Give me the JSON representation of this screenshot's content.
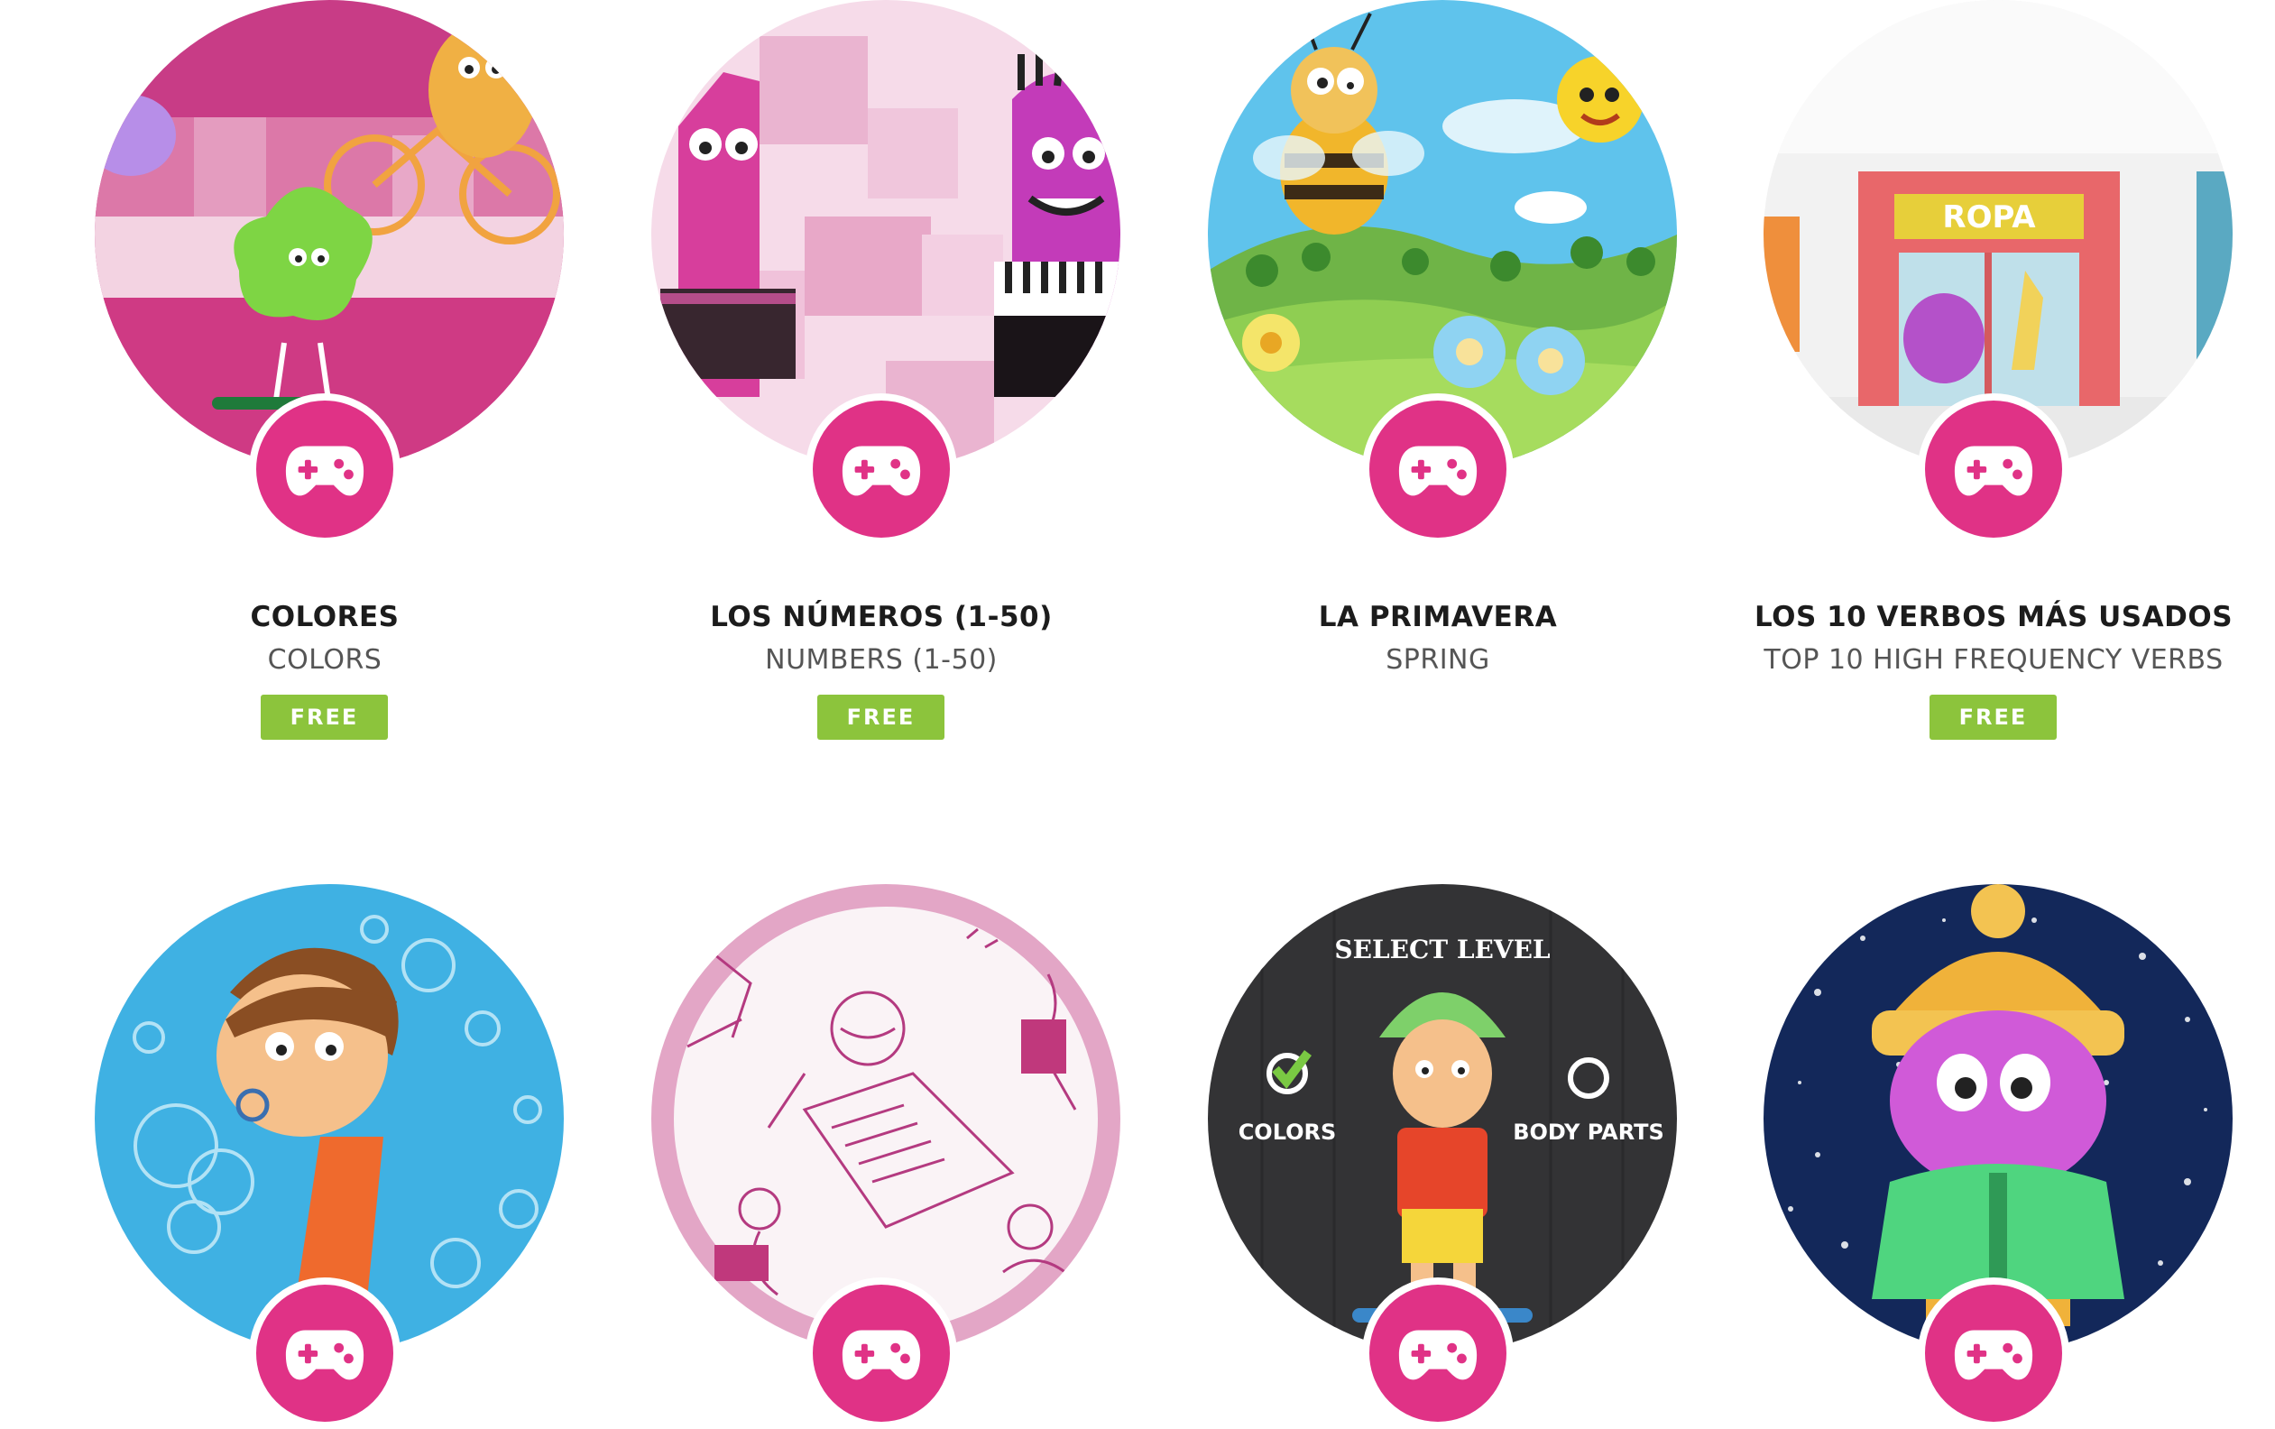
{
  "accent_color": "#e03286",
  "free_color": "#8cc43c",
  "games": [
    {
      "title": "COLORES",
      "subtitle": "COLORS",
      "badge": "FREE",
      "icon": "gamepad-icon"
    },
    {
      "title": "LOS NÚMEROS (1-50)",
      "subtitle": "NUMBERS (1-50)",
      "badge": "FREE",
      "icon": "gamepad-icon"
    },
    {
      "title": "LA PRIMAVERA",
      "subtitle": "SPRING",
      "icon": "gamepad-icon"
    },
    {
      "title": "LOS 10 VERBOS MÁS USADOS",
      "subtitle": "TOP 10 HIGH FREQUENCY VERBS",
      "badge": "FREE",
      "icon": "gamepad-icon"
    },
    {
      "icon": "gamepad-icon"
    },
    {
      "icon": "gamepad-icon"
    },
    {
      "icon": "gamepad-icon",
      "thumb_text": {
        "heading": "SELECT LEVEL",
        "option_1": "COLORS",
        "option_2": "BODY PARTS"
      }
    },
    {
      "icon": "gamepad-icon"
    }
  ],
  "shop_sign": "ROPA"
}
